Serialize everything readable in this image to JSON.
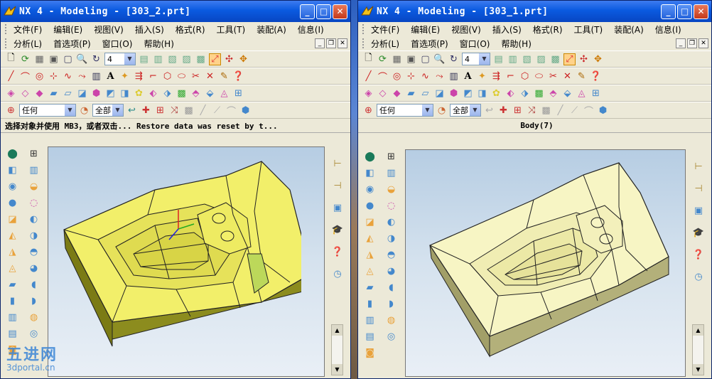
{
  "left_window": {
    "title": "NX 4 - Modeling - [303_2.prt]",
    "menu_row1": [
      "文件(F)",
      "编辑(E)",
      "视图(V)",
      "插入(S)",
      "格式(R)",
      "工具(T)",
      "装配(A)",
      "信息(I)"
    ],
    "menu_row2": [
      "分析(L)",
      "首选项(P)",
      "窗口(O)",
      "帮助(H)"
    ],
    "layer_value": "4",
    "filter_value": "任何",
    "scope_value": "全部",
    "status_text": "选择对象并使用 MB3，或者双击...   Restore data was reset by t..."
  },
  "right_window": {
    "title": "NX 4 - Modeling - [303_1.prt]",
    "menu_row1": [
      "文件(F)",
      "编辑(E)",
      "视图(V)",
      "插入(S)",
      "格式(R)",
      "工具(T)",
      "装配(A)",
      "信息(I)"
    ],
    "menu_row2": [
      "分析(L)",
      "首选项(P)",
      "窗口(O)",
      "帮助(H)"
    ],
    "layer_value": "4",
    "filter_value": "任何",
    "scope_value": "全部",
    "status_text": "Body(7)"
  },
  "watermark": {
    "big": "五进网",
    "small": "3dportal.cn"
  },
  "colors": {
    "title_blue": "#0a5ae0",
    "part_yellow": "#f2ef6a",
    "part_side_olive": "#8c8c1e",
    "part_pale": "#f7f5c4",
    "part_pale_side": "#b3b07a"
  },
  "icons": [
    "nx-logo-icon",
    "minimize-icon",
    "maximize-icon",
    "close-icon",
    "new-file-icon",
    "undo-icon",
    "zoom-icon",
    "rotate-icon",
    "line-icon",
    "arc-icon",
    "text-icon",
    "filter-icon",
    "help-icon",
    "clock-icon"
  ]
}
